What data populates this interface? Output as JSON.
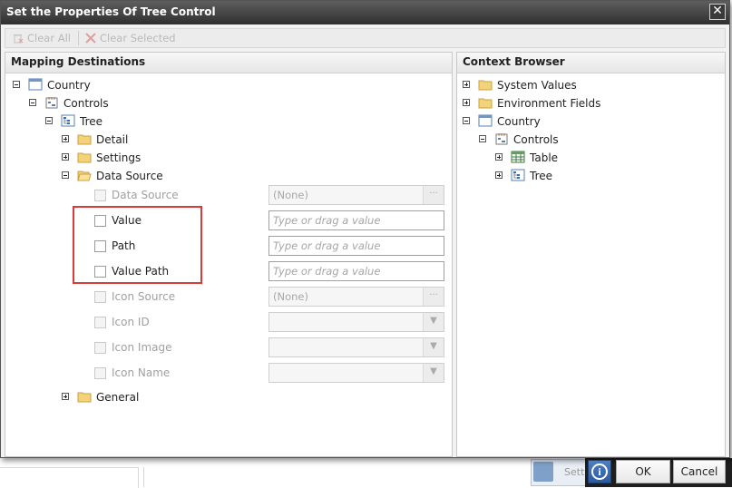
{
  "dialog": {
    "title": "Set the Properties Of Tree Control"
  },
  "toolbar": {
    "clear_all": "Clear All",
    "clear_selected": "Clear Selected"
  },
  "left_panel": {
    "header": "Mapping Destinations",
    "tree": {
      "country": "Country",
      "controls": "Controls",
      "tree": "Tree",
      "detail": "Detail",
      "settings": "Settings",
      "data_source": "Data Source",
      "general": "General"
    },
    "properties": [
      {
        "label": "Data Source",
        "value": "(None)",
        "enabled": false
      },
      {
        "label": "Value",
        "placeholder": "Type or drag a value",
        "enabled": true
      },
      {
        "label": "Path",
        "placeholder": "Type or drag a value",
        "enabled": true
      },
      {
        "label": "Value Path",
        "placeholder": "Type or drag a value",
        "enabled": true
      },
      {
        "label": "Icon Source",
        "value": "(None)",
        "enabled": false
      },
      {
        "label": "Icon ID",
        "value": "",
        "enabled": false
      },
      {
        "label": "Icon Image",
        "value": "",
        "enabled": false
      },
      {
        "label": "Icon Name",
        "value": "",
        "enabled": false
      }
    ]
  },
  "right_panel": {
    "header": "Context Browser",
    "tree": {
      "system_values": "System Values",
      "environment_fields": "Environment Fields",
      "country": "Country",
      "controls": "Controls",
      "table": "Table",
      "tree": "Tree"
    }
  },
  "footer": {
    "ok": "OK",
    "cancel": "Cancel"
  },
  "background": {
    "partial_button": "Sett"
  },
  "colors": {
    "titlebar": "#3f3f3f",
    "highlight": "#d93b3b",
    "info_button": "#2b5aa0"
  }
}
